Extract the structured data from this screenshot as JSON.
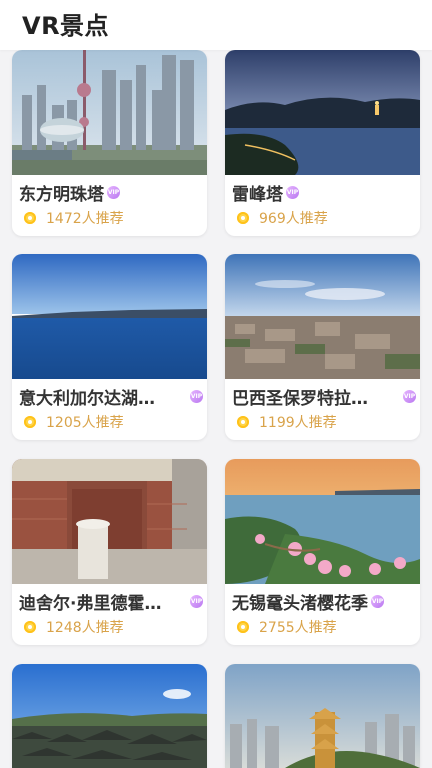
{
  "header": {
    "title": "VR景点"
  },
  "cards": [
    {
      "name": "东方明珠塔",
      "vip": "VIP",
      "recommend": "1472人推荐"
    },
    {
      "name": "雷峰塔",
      "vip": "VIP",
      "recommend": "969人推荐"
    },
    {
      "name": "意大利加尔达湖…",
      "vip": "VIP",
      "recommend": "1205人推荐"
    },
    {
      "name": "巴西圣保罗特拉…",
      "vip": "VIP",
      "recommend": "1199人推荐"
    },
    {
      "name": "迪舍尔·弗里德霍…",
      "vip": "VIP",
      "recommend": "1248人推荐"
    },
    {
      "name": "无锡鼋头渚樱花季",
      "vip": "VIP",
      "recommend": "2755人推荐"
    },
    {
      "name": "",
      "vip": "",
      "recommend": ""
    },
    {
      "name": "",
      "vip": "",
      "recommend": ""
    }
  ]
}
